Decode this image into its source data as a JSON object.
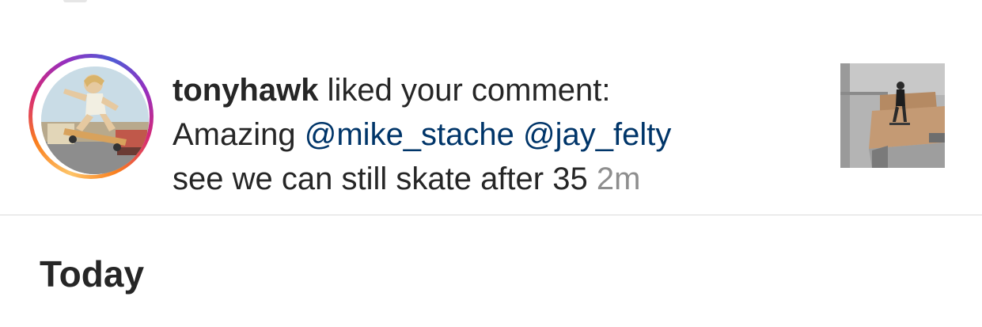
{
  "notification": {
    "username": "tonyhawk",
    "action": " liked your comment:",
    "comment_start": "Amazing ",
    "mentions": [
      "@mike_stache",
      "@jay_felty"
    ],
    "comment_end": "see we can still skate after 35",
    "timestamp": "2m",
    "avatar_ring_colors": [
      "#fdc468",
      "#fa7e1e",
      "#d62976",
      "#962fbf",
      "#4f5bd5"
    ],
    "mention_color": "#003569"
  },
  "section": {
    "title": "Today"
  }
}
